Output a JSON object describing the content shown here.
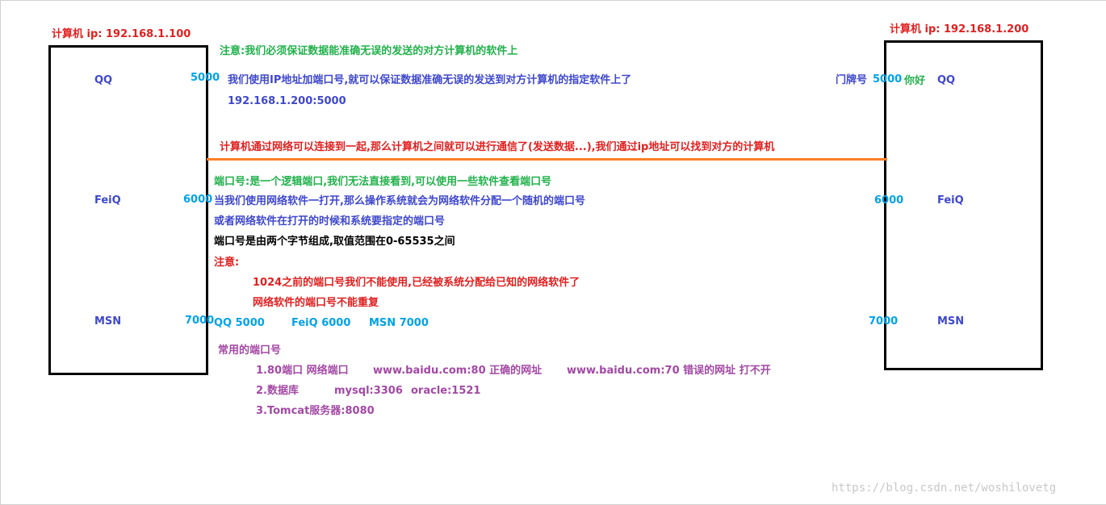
{
  "left_computer": {
    "ip_label": "计算机 ip: 192.168.1.100",
    "apps": [
      "QQ",
      "FeiQ",
      "MSN"
    ],
    "ports": [
      "5000",
      "6000",
      "7000"
    ]
  },
  "right_computer": {
    "ip_label": "计算机 ip: 192.168.1.200",
    "apps": [
      "QQ",
      "FeiQ",
      "MSN"
    ],
    "ports": [
      "5000",
      "6000",
      "7000"
    ],
    "door_label": "门牌号",
    "hello": "你好"
  },
  "notes": {
    "note_top": "注意:我们必须保证数据能准确无误的发送的对方计算机的软件上",
    "ip_port_line": "我们使用IP地址加端口号,就可以保证数据准确无误的发送到对方计算机的指定软件上了",
    "ip_port_example": "192.168.1.200:5000",
    "network_line": "计算机通过网络可以连接到一起,那么计算机之间就可以进行通信了(发送数据...),我们通过ip地址可以找到对方的计算机",
    "port_def": "端口号:是一个逻辑端口,我们无法直接看到,可以使用一些软件查看端口号",
    "port_random": "当我们使用网络软件一打开,那么操作系统就会为网络软件分配一个随机的端口号",
    "port_assigned": "或者网络软件在打开的时候和系统要指定的端口号",
    "port_range": "端口号是由两个字节组成,取值范围在0-65535之间",
    "caution_title": "注意:",
    "caution_1": "1024之前的端口号我们不能使用,已经被系统分配给已知的网络软件了",
    "caution_2": "网络软件的端口号不能重复",
    "port_list": [
      "QQ 5000",
      "FeiQ 6000",
      "MSN 7000"
    ],
    "common_title": "常用的端口号",
    "common_1a": "1.80端口 网络端口",
    "common_1b": "www.baidu.com:80 正确的网址",
    "common_1c": "www.baidu.com:70 错误的网址 打不开",
    "common_2a": "2.数据库",
    "common_2b": "mysql:3306",
    "common_2c": "oracle:1521",
    "common_3": "3.Tomcat服务器:8080"
  },
  "watermark": "https://blog.csdn.net/woshilovetg",
  "colors": {
    "red": "#e02020",
    "green": "#22b14c",
    "blue": "#3f48cc",
    "cyan": "#00a2e8",
    "purple": "#a349a4",
    "connection_line": "#ff7f27"
  }
}
